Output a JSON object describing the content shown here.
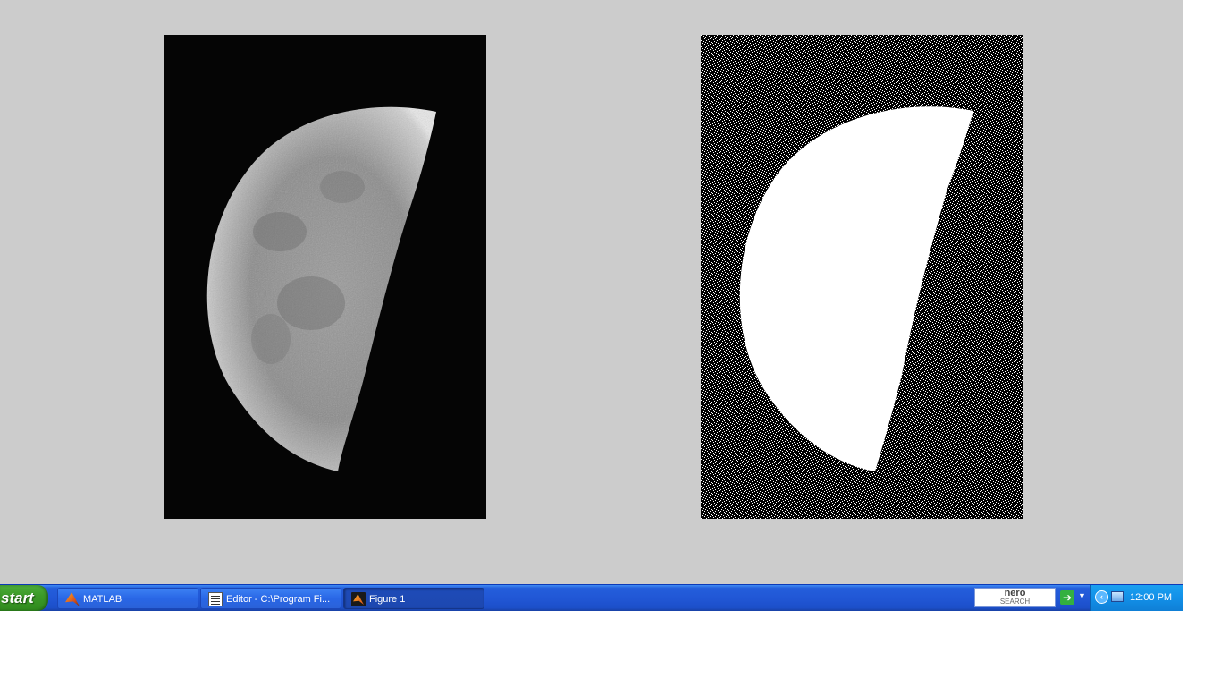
{
  "figure": {
    "images": [
      {
        "name": "original-moon-image",
        "description_name": "grayscale moon"
      },
      {
        "name": "thresholded-moon-image",
        "description_name": "binary moon"
      }
    ]
  },
  "taskbar": {
    "start_label": "start",
    "items": [
      {
        "label": "MATLAB",
        "icon": "matlab-icon",
        "active": false
      },
      {
        "label": "Editor - C:\\Program Fi...",
        "icon": "editor-icon",
        "active": false
      },
      {
        "label": "Figure 1",
        "icon": "matlab-icon",
        "active": true
      }
    ],
    "search": {
      "brand": "nero",
      "sub": "SEARCH"
    },
    "clock": "12:00 PM"
  },
  "colors": {
    "figure_bg": "#cccccc",
    "taskbar_blue": "#245edb",
    "start_green": "#3c9a28",
    "tray_blue": "#1290e8"
  }
}
